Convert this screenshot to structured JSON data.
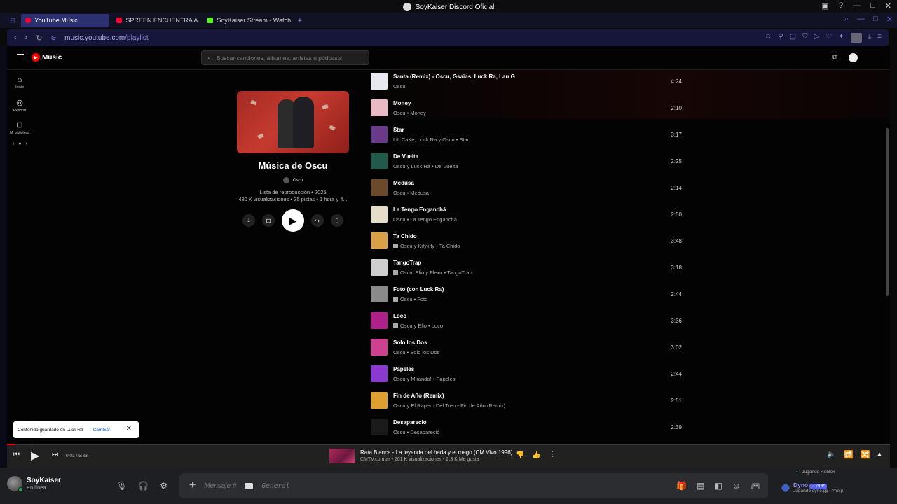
{
  "window": {
    "title": "SoyKaiser Discord Oficial"
  },
  "tabs": [
    {
      "label": "YouTube Music",
      "color": "#ff0033",
      "active": true
    },
    {
      "label": "SPREEN ENCUENTRA A S",
      "color": "#ff0033",
      "active": false
    },
    {
      "label": "SoyKaiser Stream - Watch",
      "color": "#53fc18",
      "active": false
    }
  ],
  "address": {
    "domain": "music.youtube.com",
    "path": "/playlist"
  },
  "ytm": {
    "brand": "Music",
    "search_placeholder": "Buscar canciones, álbumes, artistas o pódcasts",
    "sidebar": [
      {
        "label": "Inicio",
        "icon": "home-icon"
      },
      {
        "label": "Explorar",
        "icon": "compass-icon"
      },
      {
        "label": "Mi biblioteca",
        "icon": "library-icon"
      }
    ],
    "playlist": {
      "title": "Música de Oscu",
      "owner": "Oscu",
      "meta_line1": "Lista de reproducción • 2025",
      "meta_line2": "480 K visualizaciones • 35 pistas • 1 hora y 4..."
    },
    "tracks": [
      {
        "title": "Santa (Remix) - Oscu, Gsaias, Luck Ra, Lau G",
        "subtitle": "Oscu",
        "duration": "4:24",
        "explicit": false,
        "thumb": "#e8e8f0"
      },
      {
        "title": "Money",
        "subtitle": "Oscu • Money",
        "duration": "2:10",
        "explicit": false,
        "thumb": "#e9b9c6"
      },
      {
        "title": "Star",
        "subtitle": "LiL CaKe, Luck Ra y Oscu • Star",
        "duration": "3:17",
        "explicit": false,
        "thumb": "#6a3a8a"
      },
      {
        "title": "De Vuelta",
        "subtitle": "Oscu y Luck Ra • De Vuelta",
        "duration": "2:25",
        "explicit": false,
        "thumb": "#1f5a4a"
      },
      {
        "title": "Medusa",
        "subtitle": "Oscu • Medusa",
        "duration": "2:14",
        "explicit": false,
        "thumb": "#6a4a2a"
      },
      {
        "title": "La Tengo Enganchá",
        "subtitle": "Oscu • La Tengo Enganchá",
        "duration": "2:50",
        "explicit": false,
        "thumb": "#e6ddc8"
      },
      {
        "title": "Ta Chido",
        "subtitle": "Oscu y Kifykify • Ta Chido",
        "duration": "3:48",
        "explicit": true,
        "thumb": "#d9a04a"
      },
      {
        "title": "TangoTrap",
        "subtitle": "Oscu, Elio y Flexo • TangoTrap",
        "duration": "3:18",
        "explicit": true,
        "thumb": "#cfcfcf"
      },
      {
        "title": "Foto (con Luck Ra)",
        "subtitle": "Oscu • Foto",
        "duration": "2:44",
        "explicit": true,
        "thumb": "#8a8a8a"
      },
      {
        "title": "Loco",
        "subtitle": "Oscu y Elio • Loco",
        "duration": "3:36",
        "explicit": true,
        "thumb": "#b0208a"
      },
      {
        "title": "Solo los Dos",
        "subtitle": "Oscu • Solo los Dos",
        "duration": "3:02",
        "explicit": false,
        "thumb": "#d04090"
      },
      {
        "title": "Papeles",
        "subtitle": "Oscu y Miranda! • Papeles",
        "duration": "2:44",
        "explicit": false,
        "thumb": "#8a3ad0"
      },
      {
        "title": "Fin de Año (Remix)",
        "subtitle": "Oscu y El Rapero Del Tren • Fin de Año (Remix)",
        "duration": "2:51",
        "explicit": false,
        "thumb": "#e0a030"
      },
      {
        "title": "Desapareció",
        "subtitle": "Oscu • Desapareció",
        "duration": "2:39",
        "explicit": false,
        "thumb": "#1a1a1a"
      }
    ],
    "toast": {
      "text": "Contenido guardado en Luck Ra",
      "action": "Cambiar"
    },
    "player": {
      "time": "0:03 / 5:33",
      "progress": 0.009,
      "title": "Rata Blanca - La leyenda del hada y el mago (CM Vivo 1996)",
      "subtitle": "CMTV.com.ar • 261 K visualizaciones • 2,3 K Me gusta"
    }
  },
  "discord": {
    "username": "SoyKaiser",
    "status": "En línea",
    "message_placeholder": "Mensaje #",
    "channel": "General",
    "activity1": "Jugando Roblox",
    "bot_name": "Dyno",
    "bot_badge": "✓ APP",
    "activity2": "Jugando dyno.gg | ?help"
  },
  "colors": {
    "accent": "#ff0000",
    "discord_online": "#23a55a",
    "browser_accent": "#8a8ad8"
  }
}
